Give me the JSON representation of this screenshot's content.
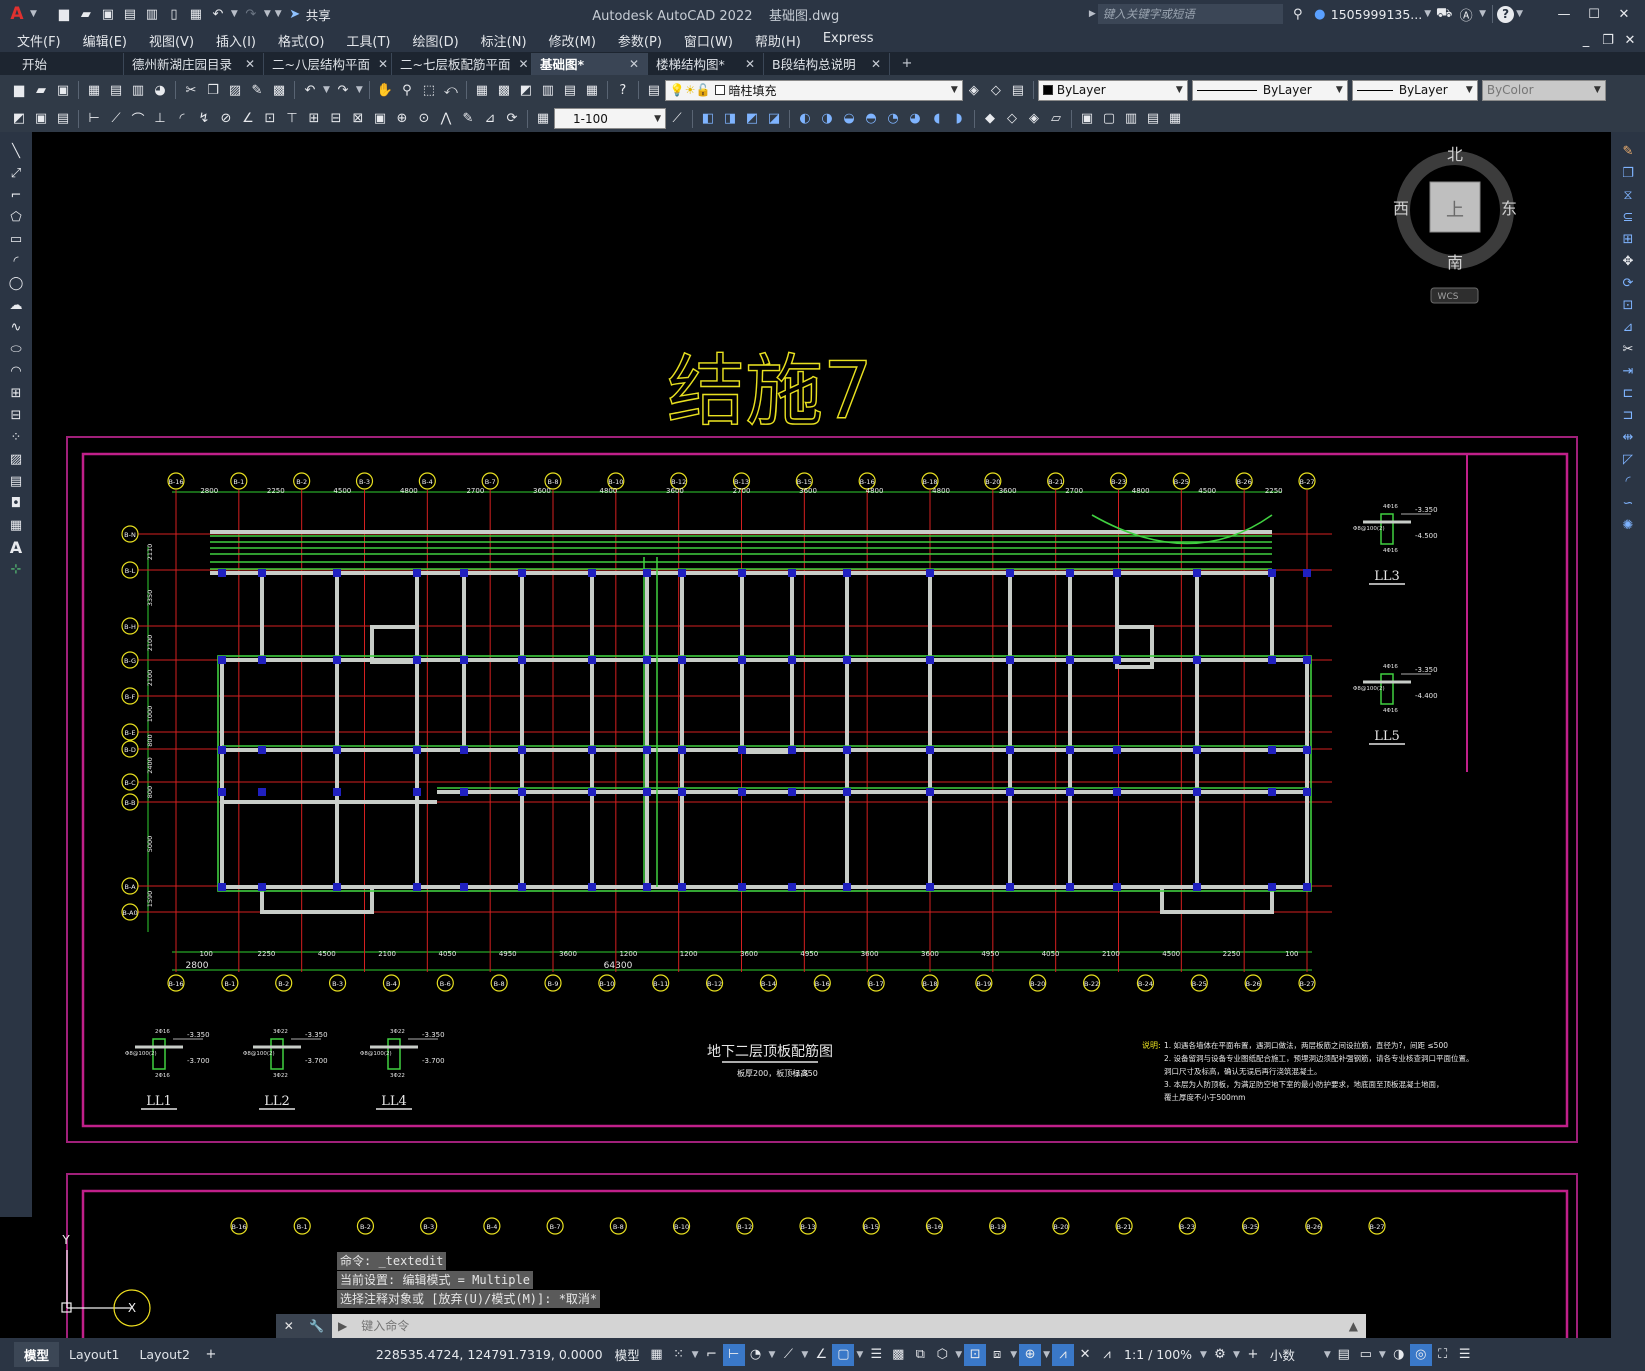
{
  "app": {
    "title": "Autodesk AutoCAD 2022",
    "document": "基础图.dwg",
    "share_label": "共享",
    "search_placeholder": "键入关键字或短语",
    "user": "1505999135...",
    "help": "?"
  },
  "menu": [
    "文件(F)",
    "编辑(E)",
    "视图(V)",
    "插入(I)",
    "格式(O)",
    "工具(T)",
    "绘图(D)",
    "标注(N)",
    "修改(M)",
    "参数(P)",
    "窗口(W)",
    "帮助(H)",
    "Express"
  ],
  "tabs": [
    {
      "label": "开始",
      "close": ""
    },
    {
      "label": "德州新湖庄园目录",
      "close": "✕"
    },
    {
      "label": "二~八层结构平面",
      "close": "✕"
    },
    {
      "label": "二~七层板配筋平面",
      "close": "✕"
    },
    {
      "label": "基础图*",
      "close": "✕"
    },
    {
      "label": "楼梯结构图*",
      "close": "✕"
    },
    {
      "label": "B段结构总说明",
      "close": "✕"
    }
  ],
  "tab_add": "+",
  "toolbar": {
    "layer": "暗柱填充",
    "color": "ByLayer",
    "linetype": "ByLayer",
    "lineweight": "ByLayer",
    "plotstyle": "ByColor",
    "scale": "1-100"
  },
  "viewcube": {
    "north": "北",
    "south": "南",
    "east": "东",
    "west": "西",
    "face": "上",
    "wcs": "WCS"
  },
  "drawing": {
    "sheet_title": "结施7",
    "plan_title": "地下二层顶板配筋图",
    "plan_subtitle": "板厚200，板顶标高",
    "plan_level": "-3.350",
    "top_axes": [
      "B-16",
      "B-1",
      "B-2",
      "B-3",
      "B-4",
      "B-7",
      "B-8",
      "B-10",
      "B-12",
      "B-13",
      "B-15",
      "B-16",
      "B-18",
      "B-20",
      "B-21",
      "B-23",
      "B-25",
      "B-26",
      "B-27"
    ],
    "bottom_axes": [
      "B-16",
      "B-1",
      "B-2",
      "B-3",
      "B-4",
      "B-6",
      "B-8",
      "B-9",
      "B-10",
      "B-11",
      "B-12",
      "B-14",
      "B-16",
      "B-17",
      "B-18",
      "B-19",
      "B-20",
      "B-22",
      "B-24",
      "B-25",
      "B-26",
      "B-27"
    ],
    "left_axes": [
      "B-N",
      "B-L",
      "B-H",
      "B-G",
      "B-F",
      "B-E",
      "B-D",
      "B-C",
      "B-B",
      "B-A",
      "B-A0"
    ],
    "top_dims": [
      "2800",
      "2250",
      "4500",
      "4800",
      "2700",
      "3600",
      "4800",
      "3600",
      "2700",
      "3600",
      "4800",
      "4800",
      "3600",
      "2700",
      "4800",
      "4500",
      "2250"
    ],
    "bottom_dims": [
      "100",
      "2250",
      "4500",
      "2100",
      "4050",
      "4950",
      "3600",
      "1200",
      "1200",
      "3600",
      "4950",
      "3600",
      "3600",
      "4950",
      "4050",
      "2100",
      "4500",
      "2250",
      "100"
    ],
    "bottom_total": "64300",
    "bottom_first": "2800",
    "left_dims": [
      "2110",
      "3350",
      "2100",
      "2100",
      "1000",
      "800",
      "2400",
      "800",
      "5000",
      "1590"
    ],
    "details": [
      {
        "name": "LL1",
        "top": "-3.350",
        "bottom": "-3.700",
        "a": "2Φ16",
        "b": "Φ8@100(2)",
        "c": "2Φ16"
      },
      {
        "name": "LL2",
        "top": "-3.350",
        "bottom": "-3.700",
        "a": "3Φ22",
        "b": "Φ8@100(2)",
        "c": "3Φ22"
      },
      {
        "name": "LL4",
        "top": "-3.350",
        "bottom": "-3.700",
        "a": "3Φ22",
        "b": "Φ8@100(2)",
        "c": "3Φ22"
      },
      {
        "name": "LL3",
        "top": "-3.350",
        "bottom": "-4.500",
        "a": "4Φ16",
        "b": "Φ8@100(2)",
        "c": "4Φ16"
      },
      {
        "name": "LL5",
        "top": "-3.350",
        "bottom": "-4.400",
        "a": "4Φ16",
        "b": "Φ8@100(2)",
        "c": "4Φ16"
      }
    ],
    "notes_label": "说明:",
    "notes": [
      "1. 如遇各墙体在平面布置，遇洞口做法，两层板筋之间设拉筋，直径为?，间距 ≤500",
      "2. 设备留洞与设备专业图纸配合施工，预埋洞边须配补强钢筋，请各专业核查洞口平面位置。",
      "洞口尺寸及标高，确认无误后再行浇筑混凝土。",
      "3. 本层为人防顶板，为满足防空地下室的最小防护要求，地底面至顶板混凝土地面，",
      "覆土厚度不小于500mm"
    ],
    "lower_axes": [
      "B-16",
      "B-1",
      "B-2",
      "B-3",
      "B-4",
      "B-7",
      "B-8",
      "B-10",
      "B-12",
      "B-13",
      "B-15",
      "B-16",
      "B-18",
      "B-20",
      "B-21",
      "B-23",
      "B-25",
      "B-26",
      "B-27"
    ],
    "ucs": {
      "y": "Y",
      "x": "X"
    }
  },
  "command": {
    "history": [
      "命令: _textedit",
      "当前设置: 编辑模式 = Multiple",
      "选择注释对象或 [放弃(U)/模式(M)]: *取消*"
    ],
    "placeholder": "键入命令"
  },
  "layouts": [
    "模型",
    "Layout1",
    "Layout2"
  ],
  "status": {
    "coords": "228535.4724, 124791.7319, 0.0000",
    "model": "模型",
    "scale": "1:1 / 100%",
    "units": "小数"
  }
}
